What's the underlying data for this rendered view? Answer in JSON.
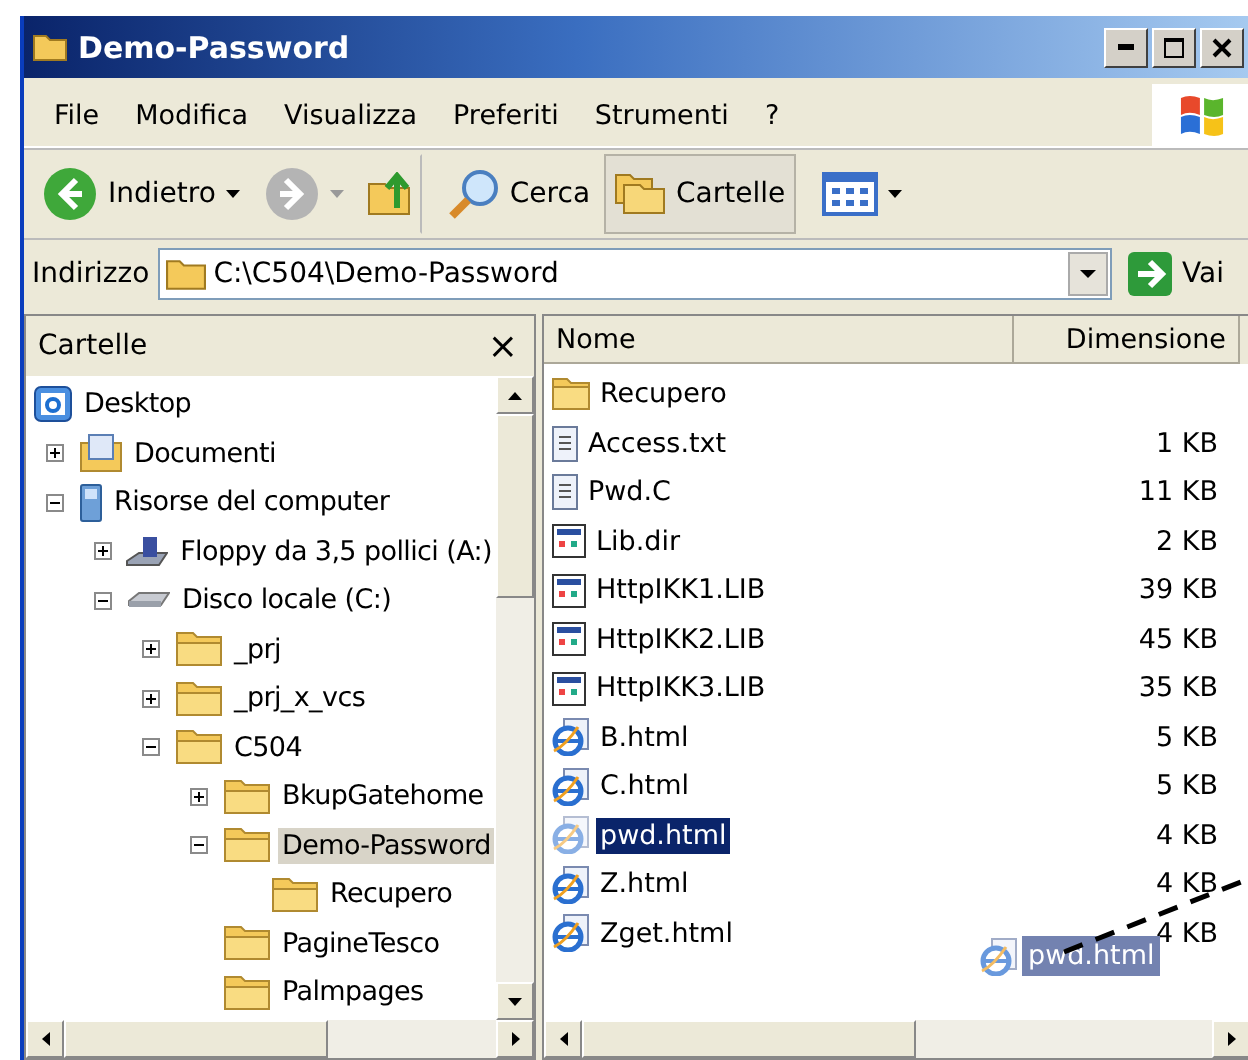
{
  "window": {
    "title": "Demo-Password"
  },
  "menu": [
    "File",
    "Modifica",
    "Visualizza",
    "Preferiti",
    "Strumenti",
    "?"
  ],
  "toolbar": [
    {
      "kind": "back",
      "label": "Indietro",
      "disabled": false
    },
    {
      "kind": "forward",
      "disabled": true
    },
    {
      "kind": "up"
    },
    {
      "kind": "search",
      "label": "Cerca",
      "selected": false
    },
    {
      "kind": "folders",
      "label": "Cartelle",
      "selected": true
    },
    {
      "kind": "views"
    }
  ],
  "address": {
    "label": "Indirizzo",
    "value": "C:\\C504\\Demo-Password",
    "go": "Vai"
  },
  "folders_panel": {
    "title": "Cartelle",
    "close": "×",
    "tree": [
      {
        "label": "Desktop",
        "kind": "desktop",
        "selected": false,
        "children": [
          {
            "label": "Documenti",
            "kind": "documents",
            "expanded": false,
            "selected": false
          },
          {
            "label": "Risorse del computer",
            "kind": "computer",
            "expanded": true,
            "selected": false,
            "children": [
              {
                "label": "Floppy da 3,5 pollici (A:)",
                "kind": "floppy",
                "expanded": false,
                "selected": false
              },
              {
                "label": "Disco locale (C:)",
                "kind": "drive",
                "expanded": true,
                "selected": false,
                "children": [
                  {
                    "label": "_prj",
                    "kind": "folder",
                    "expanded": false,
                    "selected": false
                  },
                  {
                    "label": "_prj_x_vcs",
                    "kind": "folder",
                    "expanded": false,
                    "selected": false
                  },
                  {
                    "label": "C504",
                    "kind": "folder",
                    "expanded": true,
                    "selected": false,
                    "children": [
                      {
                        "label": "BkupGatehome",
                        "kind": "folder",
                        "expanded": false,
                        "selected": false
                      },
                      {
                        "label": "Demo-Password",
                        "kind": "folder",
                        "expanded": true,
                        "selected": true,
                        "children": [
                          {
                            "label": "Recupero",
                            "kind": "folder",
                            "selected": false
                          }
                        ]
                      },
                      {
                        "label": "PagineTesco",
                        "kind": "folder",
                        "selected": false
                      },
                      {
                        "label": "Palmpages",
                        "kind": "folder",
                        "selected": false
                      }
                    ]
                  }
                ]
              }
            ]
          }
        ]
      }
    ]
  },
  "files": {
    "columns": [
      "Nome",
      "Dimensione"
    ],
    "rows": [
      {
        "name": "Recupero",
        "kind": "folder",
        "selected": false
      },
      {
        "name": "Access.txt",
        "size": "1 KB",
        "kind": "text",
        "selected": false
      },
      {
        "name": "Pwd.C",
        "size": "11 KB",
        "kind": "text",
        "selected": false
      },
      {
        "name": "Lib.dir",
        "size": "2 KB",
        "kind": "lib",
        "selected": false
      },
      {
        "name": "HttpIKK1.LIB",
        "size": "39 KB",
        "kind": "lib",
        "selected": false
      },
      {
        "name": "HttpIKK2.LIB",
        "size": "45 KB",
        "kind": "lib",
        "selected": false
      },
      {
        "name": "HttpIKK3.LIB",
        "size": "35 KB",
        "kind": "lib",
        "selected": false
      },
      {
        "name": "B.html",
        "size": "5 KB",
        "kind": "html",
        "selected": false
      },
      {
        "name": "C.html",
        "size": "5 KB",
        "kind": "html",
        "selected": false
      },
      {
        "name": "pwd.html",
        "size": "4 KB",
        "kind": "html",
        "selected": true
      },
      {
        "name": "Z.html",
        "size": "4 KB",
        "kind": "html",
        "selected": false
      },
      {
        "name": "Zget.html",
        "size": "4 KB",
        "kind": "html",
        "selected": false
      }
    ],
    "drag_ghost": {
      "label": "pwd.html"
    }
  }
}
